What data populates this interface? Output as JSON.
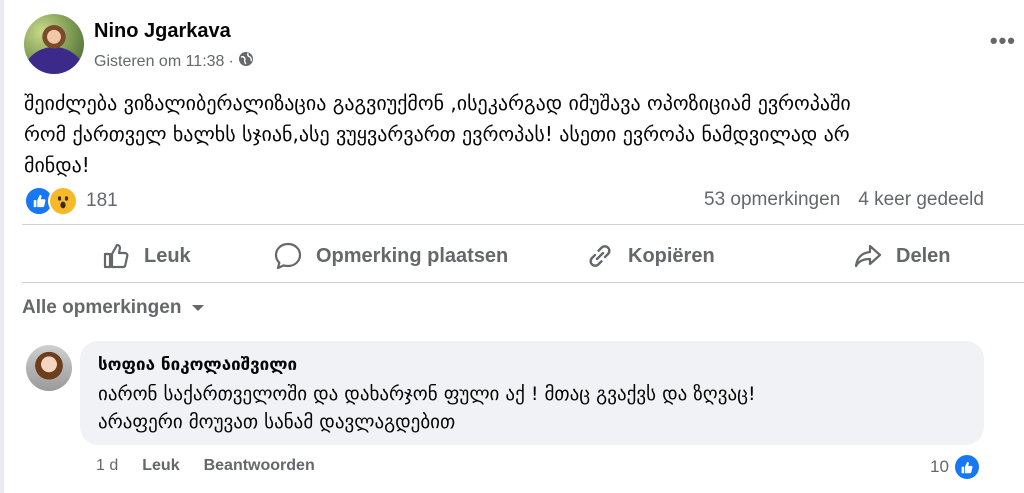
{
  "post": {
    "author": "Nino Jgarkava",
    "timestamp": "Gisteren om 11:38",
    "separator": "·",
    "privacy_icon": "globe-icon",
    "text": "შეიძლება ვიზალიბერალიზაცია გაგვიუქმონ ,ისეკარგად იმუშავა ოპოზიციამ ევროპაში\nრომ ქართველ ხალხს სჯიან,ასე ვუყვარვართ ევროპას! ასეთი ევროპა ნამდვილად არ\nმინდა!",
    "more_label": "•••"
  },
  "reactions": {
    "icons": [
      "like-icon",
      "wow-icon"
    ],
    "count": "181",
    "comments": "53 opmerkingen",
    "shares": "4 keer gedeeld"
  },
  "actions": {
    "like": "Leuk",
    "comment": "Opmerking plaatsen",
    "copy": "Kopiëren",
    "share": "Delen"
  },
  "comments_filter": "Alle opmerkingen",
  "comment": {
    "author": "სოფია ნიკოლაიშვილი",
    "text": "იარონ საქართველოში და დახარჯონ ფული აქ ! მთაც გვაქვს და ზღვაც!\nარაფერი მოუვათ სანამ დავლაგდებით",
    "age": "1 d",
    "like": "Leuk",
    "reply": "Beantwoorden",
    "like_count": "10"
  },
  "colors": {
    "brand": "#1877f2",
    "secondary_text": "#65676b",
    "bubble": "#f0f2f5"
  }
}
